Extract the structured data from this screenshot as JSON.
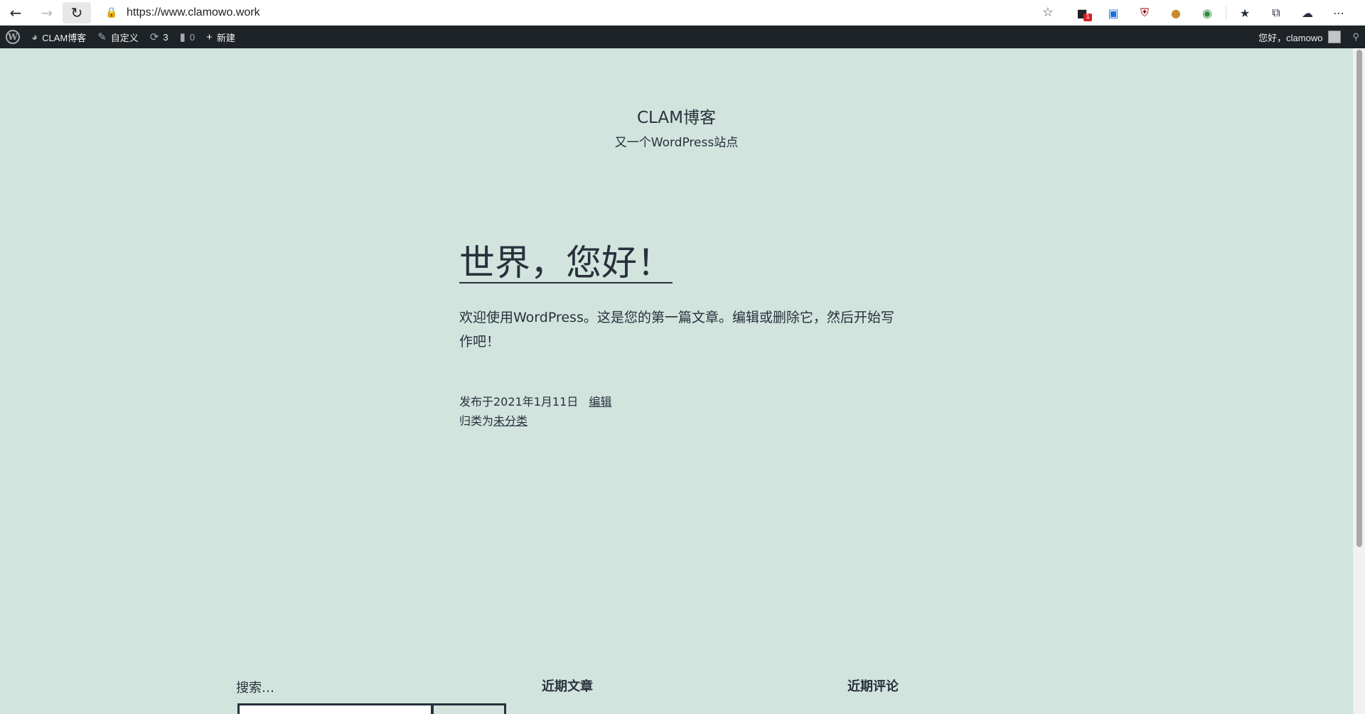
{
  "browser": {
    "url": "https://www.clamowo.work",
    "back_icon": "arrow-left-icon",
    "forward_icon": "arrow-right-icon",
    "reload_icon": "reload-icon",
    "ext_badge": "1"
  },
  "admin_bar": {
    "site_name": "CLAM博客",
    "customize": "自定义",
    "updates_count": "3",
    "comments_count": "0",
    "new_label": "新建",
    "greeting": "您好，clamowo"
  },
  "site": {
    "title": "CLAM博客",
    "description": "又一个WordPress站点"
  },
  "post": {
    "title": "世界，您好！",
    "body": "欢迎使用WordPress。这是您的第一篇文章。编辑或删除它，然后开始写作吧！",
    "published": "发布于2021年1月11日",
    "edit_link": "编辑",
    "category_prefix": "归类为",
    "category": "未分类"
  },
  "widgets": {
    "search_label": "搜索…",
    "recent_posts_heading": "近期文章",
    "recent_comments_heading": "近期评论"
  },
  "colors": {
    "page_bg": "#d1e4dd",
    "text": "#28303d",
    "admin_bar_bg": "#1d2327"
  }
}
